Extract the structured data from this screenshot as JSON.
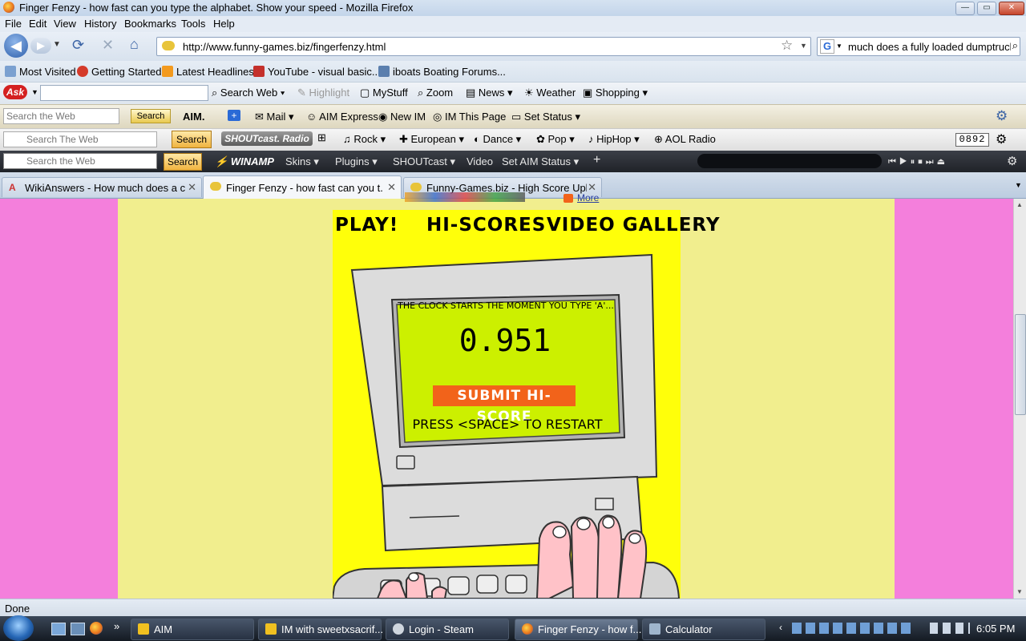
{
  "window": {
    "title": "Finger Fenzy - how fast can you type the alphabet. Show your speed - Mozilla Firefox",
    "controls": {
      "minimize": "—",
      "maximize": "▭",
      "close": "✕"
    }
  },
  "menubar": {
    "items": [
      "File",
      "Edit",
      "View",
      "History",
      "Bookmarks",
      "Tools",
      "Help"
    ]
  },
  "navbar": {
    "url": "http://www.funny-games.biz/fingerfenzy.html",
    "search_value": "much does a fully loaded dumptruck",
    "search_engine_letter": "G"
  },
  "bookmarks": {
    "items": [
      "Most Visited",
      "Getting Started",
      "Latest Headlines",
      "YouTube - visual basic...",
      "iboats Boating Forums..."
    ]
  },
  "ask_toolbar": {
    "logo": "Ask",
    "items": [
      "Search Web",
      "Highlight",
      "MyStuff",
      "Zoom",
      "News",
      "Weather",
      "Shopping"
    ]
  },
  "aim_toolbar": {
    "search_placeholder": "Search the Web",
    "search_button": "Search",
    "items": [
      "AIM.",
      "Mail",
      "AIM Express",
      "New IM",
      "IM This Page",
      "Set Status"
    ]
  },
  "shoutcast_toolbar": {
    "search_placeholder": "Search The Web",
    "search_button": "Search",
    "logo": "SHOUTcast. Radio",
    "items": [
      "Rock",
      "European",
      "Dance",
      "Pop",
      "HipHop",
      "AOL Radio"
    ],
    "counter": "0892"
  },
  "winamp_toolbar": {
    "search_placeholder": "Search the Web",
    "search_button": "Search",
    "logo": "WINAMP",
    "items": [
      "Skins",
      "Plugins",
      "SHOUTcast",
      "Video",
      "Set AIM Status"
    ]
  },
  "tabs": [
    {
      "label": "WikiAnswers - How much does a c...",
      "active": false
    },
    {
      "label": "Finger Fenzy - how fast can you t...",
      "active": true
    },
    {
      "label": "Funny-Games.biz - High Score Uplo...",
      "active": false
    }
  ],
  "page": {
    "share_more": "More",
    "nav": [
      "PLAY!",
      "HI-SCORES",
      "VIDEO GALLERY"
    ],
    "instruction": "THE CLOCK STARTS THE MOMENT YOU TYPE 'A'...",
    "time": "0.951",
    "submit_button": "SUBMIT HI-SCORE",
    "restart": "PRESS <SPACE> TO RESTART"
  },
  "status": {
    "text": "Done"
  },
  "taskbar": {
    "tasks": [
      {
        "label": "AIM",
        "active": false
      },
      {
        "label": "IM with sweetxsacrif...",
        "active": false
      },
      {
        "label": "Login - Steam",
        "active": false
      },
      {
        "label": "Finger Fenzy - how f...",
        "active": true
      },
      {
        "label": "Calculator",
        "active": false
      }
    ],
    "clock": "6:05 PM"
  },
  "colors": {
    "page_bg": "#f47fdc",
    "content_bg": "#f1ee8e",
    "game_bg": "#ffff0a",
    "screen_bg": "#ccf000",
    "submit_bg": "#f2631a"
  }
}
